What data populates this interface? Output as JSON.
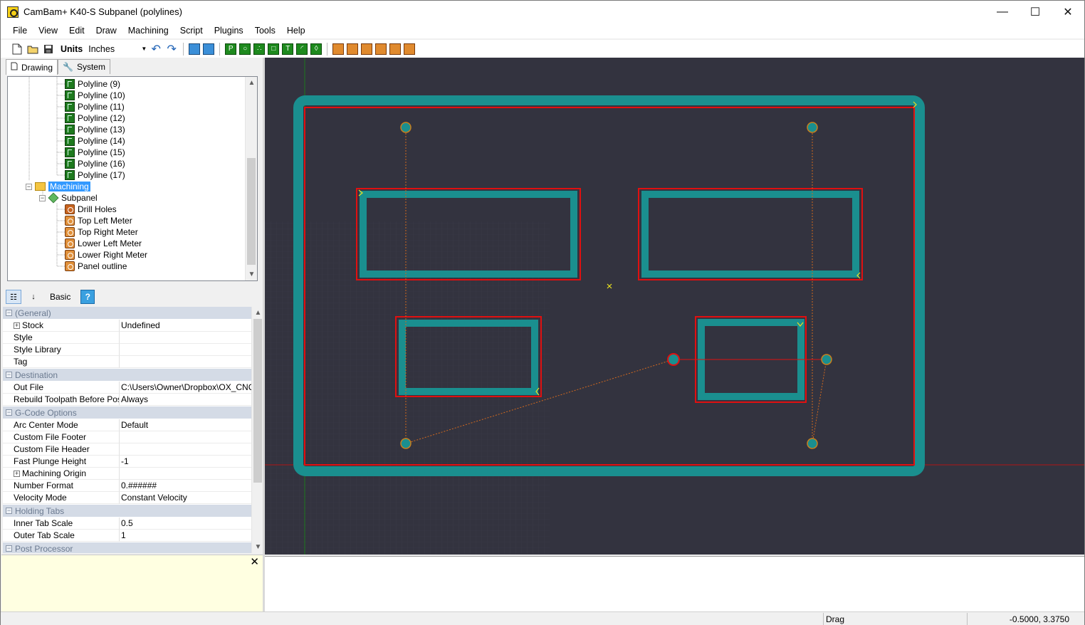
{
  "window": {
    "title": "CamBam+  K40-S Subpanel (polylines)",
    "minimize": "—",
    "maximize": "☐",
    "close": "✕"
  },
  "menu": [
    "File",
    "View",
    "Edit",
    "Draw",
    "Machining",
    "Script",
    "Plugins",
    "Tools",
    "Help"
  ],
  "toolbar": {
    "units_label": "Units",
    "units_value": "Inches"
  },
  "tabs": {
    "drawing": "Drawing",
    "system": "System"
  },
  "tree": {
    "polylines": [
      "Polyline (9)",
      "Polyline (10)",
      "Polyline (11)",
      "Polyline (12)",
      "Polyline (13)",
      "Polyline (14)",
      "Polyline (15)",
      "Polyline (16)",
      "Polyline (17)"
    ],
    "machining": "Machining",
    "part": "Subpanel",
    "operations": [
      "Drill Holes",
      "Top Left Meter",
      "Top Right Meter",
      "Lower Left Meter",
      "Lower Right Meter",
      "Panel outline"
    ]
  },
  "prop_toolbar": {
    "basic": "Basic",
    "help": "?"
  },
  "properties": {
    "general": {
      "label": "(General)",
      "rows": [
        {
          "name": "Stock",
          "value": "Undefined"
        },
        {
          "name": "Style",
          "value": ""
        },
        {
          "name": "Style Library",
          "value": ""
        },
        {
          "name": "Tag",
          "value": ""
        }
      ]
    },
    "destination": {
      "label": "Destination",
      "rows": [
        {
          "name": "Out File",
          "value": "C:\\Users\\Owner\\Dropbox\\OX_CNC\\C"
        },
        {
          "name": "Rebuild Toolpath Before Post",
          "value": "Always"
        }
      ]
    },
    "gcode": {
      "label": "G-Code Options",
      "rows": [
        {
          "name": "Arc Center Mode",
          "value": "Default"
        },
        {
          "name": "Custom File Footer",
          "value": ""
        },
        {
          "name": "Custom File Header",
          "value": ""
        },
        {
          "name": "Fast Plunge Height",
          "value": "-1"
        },
        {
          "name": "Machining Origin",
          "value": ""
        },
        {
          "name": "Number Format",
          "value": "0.######"
        },
        {
          "name": "Velocity Mode",
          "value": "Constant Velocity"
        }
      ]
    },
    "tabs": {
      "label": "Holding Tabs",
      "rows": [
        {
          "name": "Inner Tab Scale",
          "value": "0.5"
        },
        {
          "name": "Outer Tab Scale",
          "value": "1"
        }
      ]
    },
    "post": {
      "label": "Post Processor"
    }
  },
  "status": {
    "mode": "Drag",
    "coords": "-0.5000, 3.3750"
  },
  "colors": {
    "canvas_bg": "#33333f",
    "toolpath": "#1a8f8f",
    "outline": "#e01010",
    "rapid": "#d2691e"
  }
}
